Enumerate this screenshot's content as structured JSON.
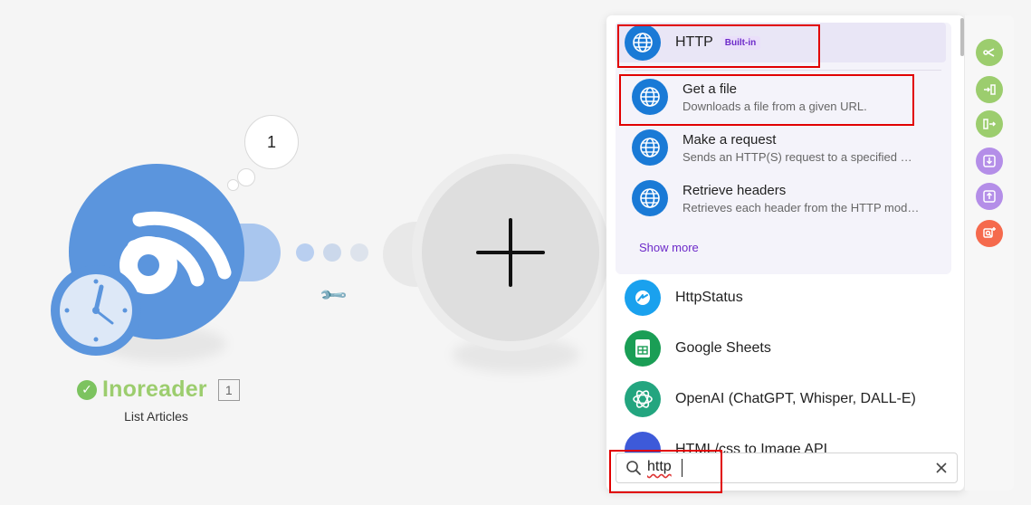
{
  "scenario": {
    "bubble_count": "1",
    "module": {
      "name": "Inoreader",
      "number": "1",
      "subtitle": "List Articles",
      "color": "#5b95dd",
      "status_icon": "check-circle-icon"
    },
    "add_module_icon": "plus-icon",
    "settings_icon": "wrench-icon"
  },
  "panel": {
    "http_app": {
      "name": "HTTP",
      "badge": "Built-in",
      "icon": "globe-icon"
    },
    "http_actions": [
      {
        "title": "Get a file",
        "description": "Downloads a file from a given URL."
      },
      {
        "title": "Make a request",
        "description": "Sends an HTTP(S) request to a specified URL and processes the response."
      },
      {
        "title": "Retrieve headers",
        "description": "Retrieves each header from the HTTP module response."
      }
    ],
    "show_more": "Show more",
    "other_apps": [
      {
        "name": "HttpStatus",
        "icon": "httpstatus-icon",
        "color": "#1aa1ee"
      },
      {
        "name": "Google Sheets",
        "icon": "sheets-icon",
        "color": "#1a9e55"
      },
      {
        "name": "OpenAI (ChatGPT, Whisper, DALL-E)",
        "icon": "openai-icon",
        "color": "#23a57f"
      },
      {
        "name": "HTML/css to Image API",
        "icon": "app-icon",
        "color": "#3d5ad9"
      }
    ],
    "search": {
      "value": "http",
      "icon": "search-icon",
      "clear_icon": "close-icon"
    }
  },
  "toolbar": [
    {
      "icon": "flow-control-icon",
      "color": "#9ccd6e"
    },
    {
      "icon": "aggregator-icon",
      "color": "#9ccd6e"
    },
    {
      "icon": "iterator-icon",
      "color": "#9ccd6e"
    },
    {
      "icon": "import-icon",
      "color": "#b48ee8"
    },
    {
      "icon": "export-icon",
      "color": "#b48ee8"
    },
    {
      "icon": "search-plus-icon",
      "color": "#f56a4d"
    }
  ]
}
